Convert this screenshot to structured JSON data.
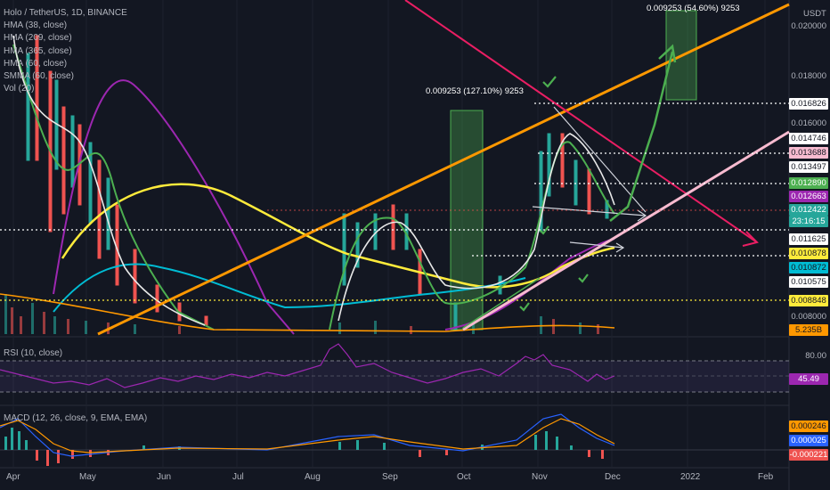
{
  "header": {
    "symbol": "Holo / TetherUS, 1D, BINANCE"
  },
  "indicators": [
    {
      "label": "HMA (38, close)"
    },
    {
      "label": "HMA (209, close)"
    },
    {
      "label": "HMA (365, close)"
    },
    {
      "label": "HMA (60, close)"
    },
    {
      "label": "SMMA (60, close)"
    },
    {
      "label": "Vol (20)"
    }
  ],
  "rsi": {
    "label": "RSI (10, close)",
    "level": "80.00",
    "value": "45.49"
  },
  "macd": {
    "label": "MACD (12, 26, close, 9, EMA, EMA)",
    "values": [
      "0.000246",
      "0.000025",
      "-0.000221"
    ]
  },
  "price_axis": {
    "currency": "USDT",
    "labels": [
      "0.020000",
      "0.018000",
      "0.016000",
      "0.008000"
    ],
    "tags": [
      {
        "text": "0.016826",
        "bg": "#ffffff",
        "fg": "#131722"
      },
      {
        "text": "0.014746",
        "bg": "#ffffff",
        "fg": "#131722"
      },
      {
        "text": "0.013688",
        "bg": "#f8bbd0",
        "fg": "#131722"
      },
      {
        "text": "0.013497",
        "bg": "#ffffff",
        "fg": "#131722"
      },
      {
        "text": "0.012890",
        "bg": "#4caf50",
        "fg": "#ffffff"
      },
      {
        "text": "0.012663",
        "bg": "#9c27b0",
        "fg": "#ffffff"
      },
      {
        "text": "0.012422",
        "bg": "#26a69a",
        "fg": "#ffffff"
      },
      {
        "text": "23:16:15",
        "bg": "#26a69a",
        "fg": "#ffffff"
      },
      {
        "text": "0.011625",
        "bg": "#ffffff",
        "fg": "#131722"
      },
      {
        "text": "0.010878",
        "bg": "#ffeb3b",
        "fg": "#131722"
      },
      {
        "text": "0.010872",
        "bg": "#00bcd4",
        "fg": "#131722"
      },
      {
        "text": "0.010575",
        "bg": "#ffffff",
        "fg": "#131722"
      },
      {
        "text": "0.008848",
        "bg": "#ffeb3b",
        "fg": "#131722"
      },
      {
        "text": "5.235B",
        "bg": "#ff9800",
        "fg": "#131722"
      }
    ]
  },
  "measures": [
    {
      "text": "0.009253 (127.10%) 9253"
    },
    {
      "text": "0.009253 (54.60%) 9253"
    }
  ],
  "time_axis": [
    "Apr",
    "May",
    "Jun",
    "Jul",
    "Aug",
    "Sep",
    "Oct",
    "Nov",
    "Dec",
    "2022",
    "Feb"
  ],
  "colors": {
    "background": "#131722",
    "up": "#26a69a",
    "down": "#ef5350",
    "trend_orange": "#ff9800",
    "trend_pink": "#e91e63"
  }
}
